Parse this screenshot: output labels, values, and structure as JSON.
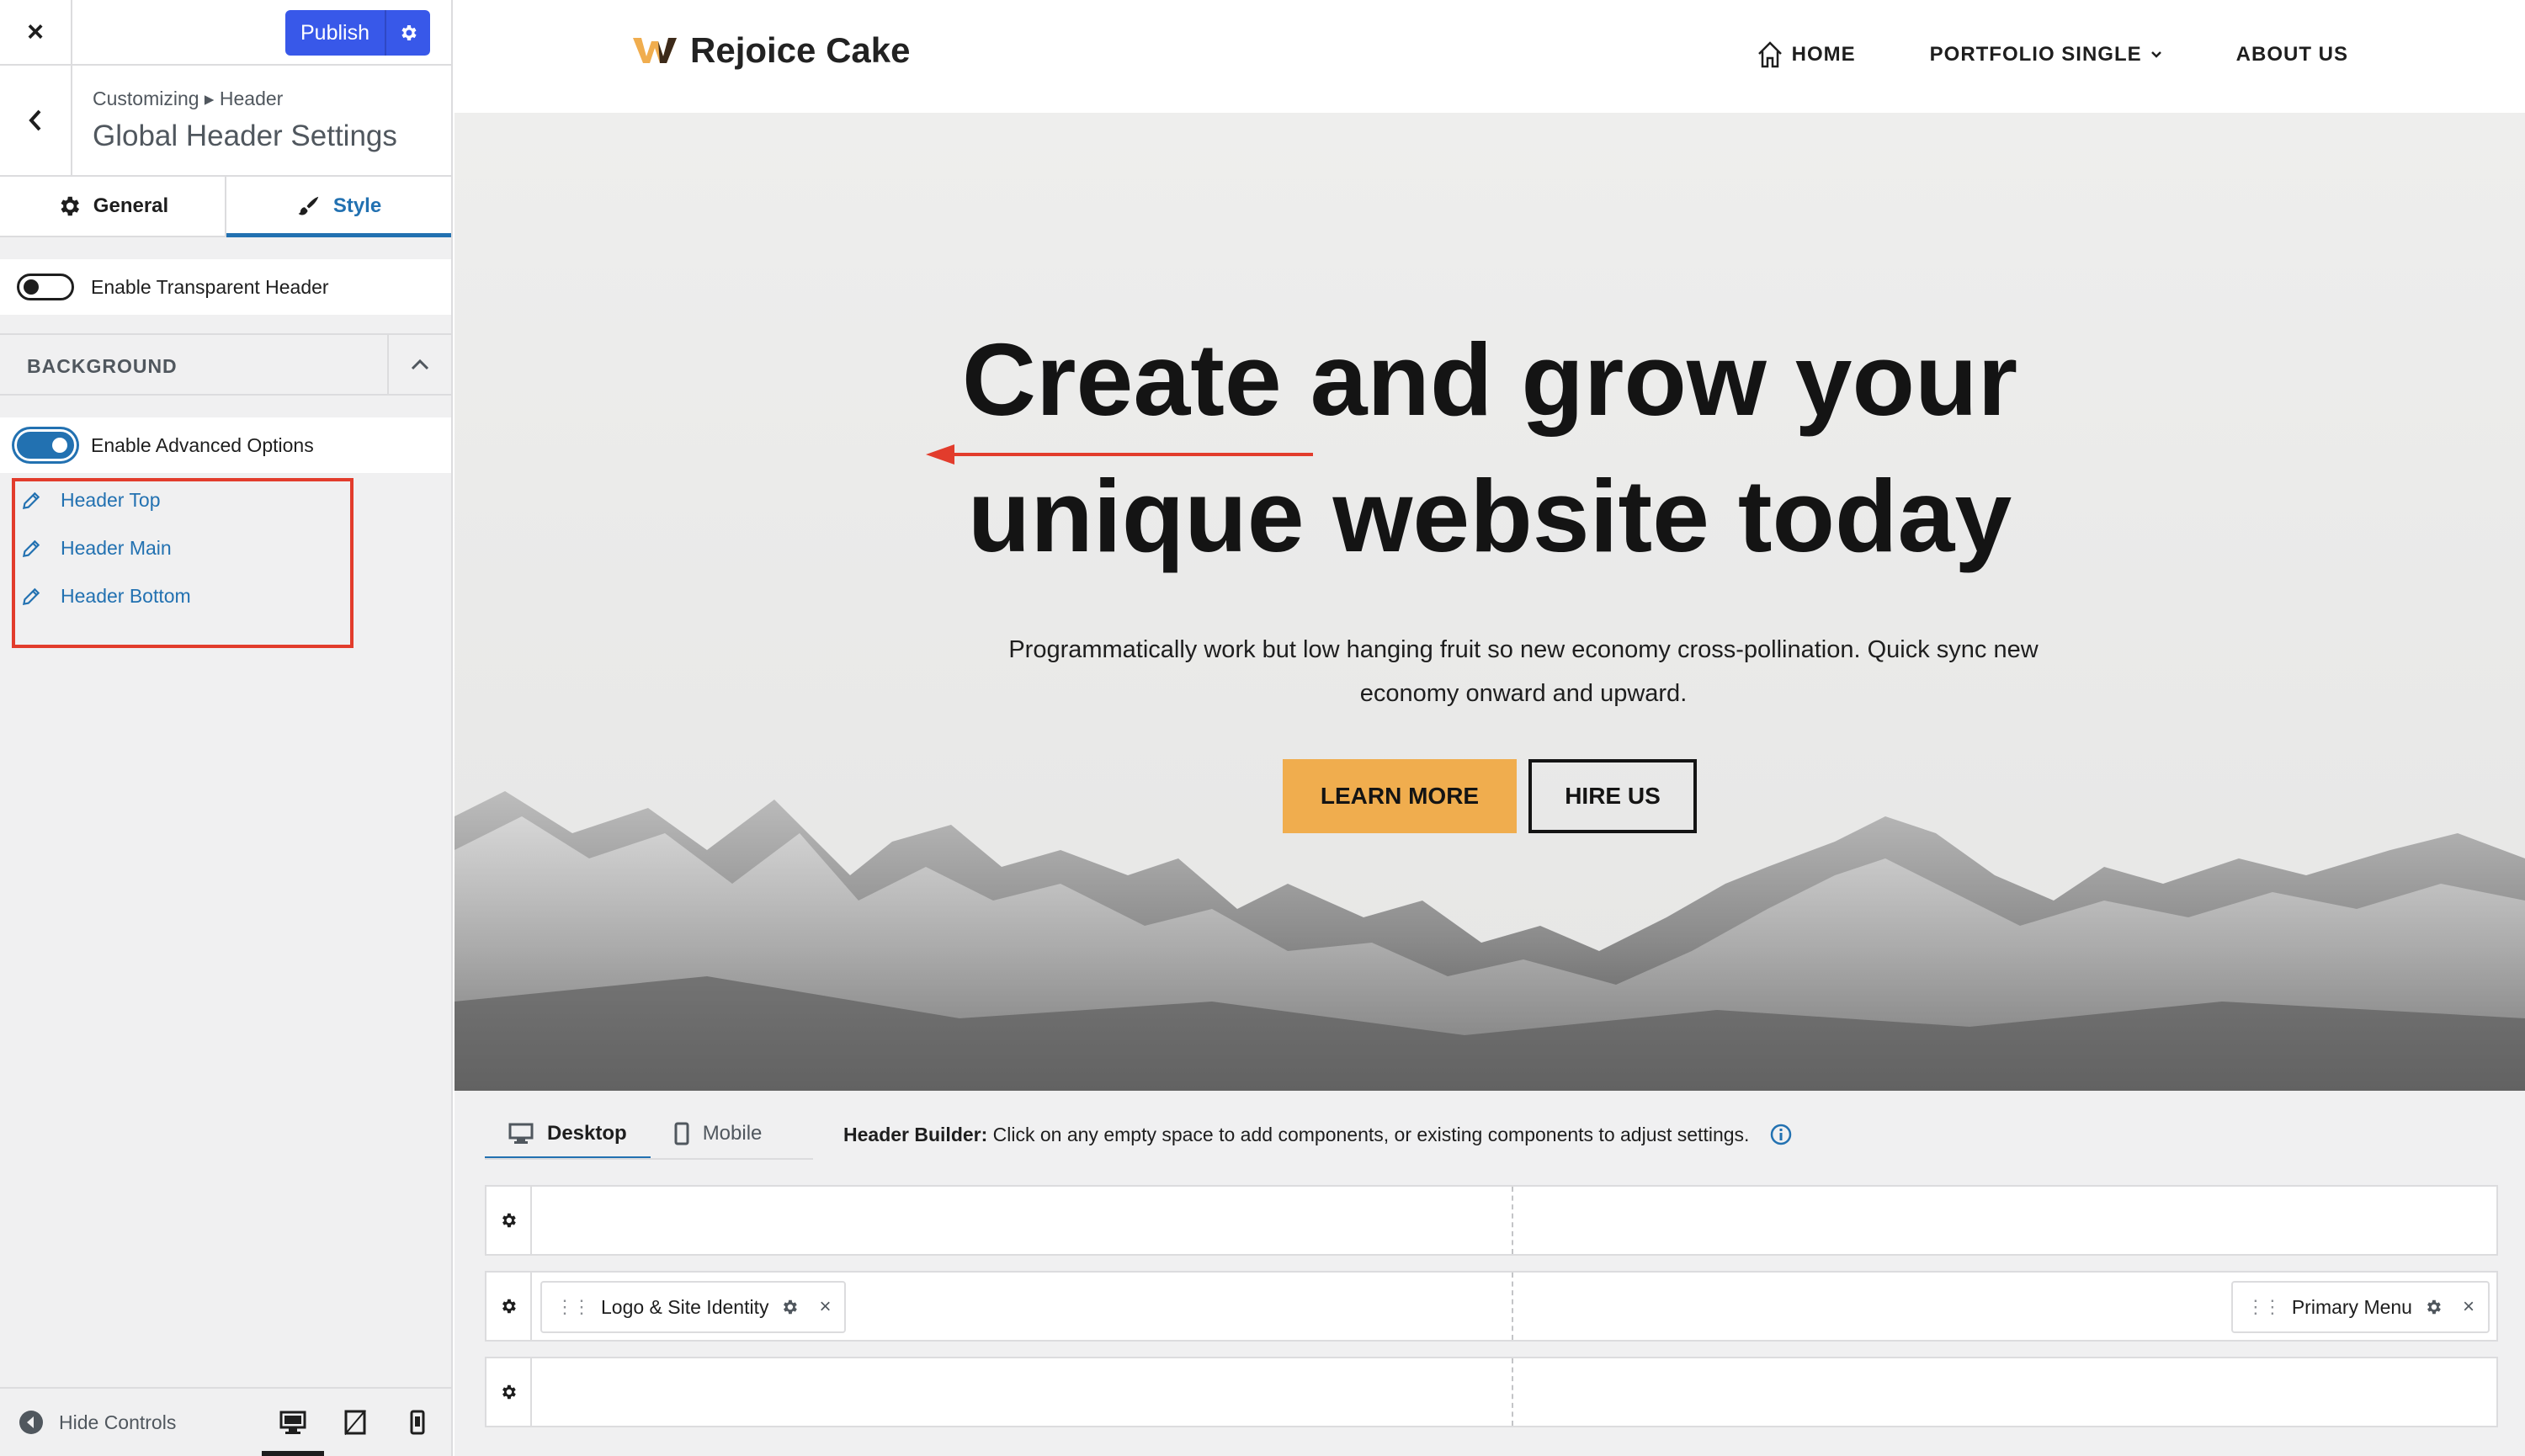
{
  "sidebar": {
    "close_label": "×",
    "publish_label": "Publish",
    "breadcrumb": "Customizing ▸ Header",
    "title": "Global Header Settings",
    "tabs": [
      {
        "label": "General",
        "icon": "gear-icon"
      },
      {
        "label": "Style",
        "icon": "paintbrush-icon",
        "active": true
      }
    ],
    "transparent_header": {
      "label": "Enable Transparent Header",
      "enabled": false
    },
    "background_section": {
      "title": "BACKGROUND",
      "expanded": true
    },
    "advanced_options": {
      "label": "Enable Advanced Options",
      "enabled": true
    },
    "links": [
      {
        "label": "Header Top",
        "icon": "pencil-icon"
      },
      {
        "label": "Header Main",
        "icon": "pencil-icon"
      },
      {
        "label": "Header Bottom",
        "icon": "pencil-icon"
      }
    ],
    "footer": {
      "hide_controls": "Hide Controls",
      "active_device": "desktop"
    }
  },
  "preview": {
    "site_name": "Rejoice Cake",
    "nav": [
      {
        "label": "HOME",
        "icon": "home-icon"
      },
      {
        "label": "PORTFOLIO SINGLE",
        "icon": "chevron-down-icon"
      },
      {
        "label": "ABOUT US"
      }
    ],
    "hero": {
      "title_line1": "Create and grow your",
      "title_line2": "unique website today",
      "subtitle_line1": "Programmatically work but low hanging fruit so new economy cross-pollination. Quick sync new",
      "subtitle_line2": "economy onward and upward.",
      "primary_button": "LEARN MORE",
      "secondary_button": "HIRE US"
    }
  },
  "builder": {
    "tabs": [
      {
        "label": "Desktop",
        "icon": "desktop-icon",
        "active": true
      },
      {
        "label": "Mobile",
        "icon": "mobile-icon"
      }
    ],
    "info_label": "Header Builder:",
    "info_text": "Click on any empty space to add components, or existing components to adjust settings.",
    "rows": [
      {
        "name": "top",
        "left": [],
        "right": []
      },
      {
        "name": "main",
        "left": [
          {
            "label": "Logo & Site Identity"
          }
        ],
        "right": [
          {
            "label": "Primary Menu"
          }
        ]
      },
      {
        "name": "bottom",
        "left": [],
        "right": []
      }
    ]
  },
  "colors": {
    "accent": "#2271b1",
    "publish": "#3858e9",
    "learn_more": "#f0ad4e",
    "highlight_red": "#e23c2c"
  }
}
